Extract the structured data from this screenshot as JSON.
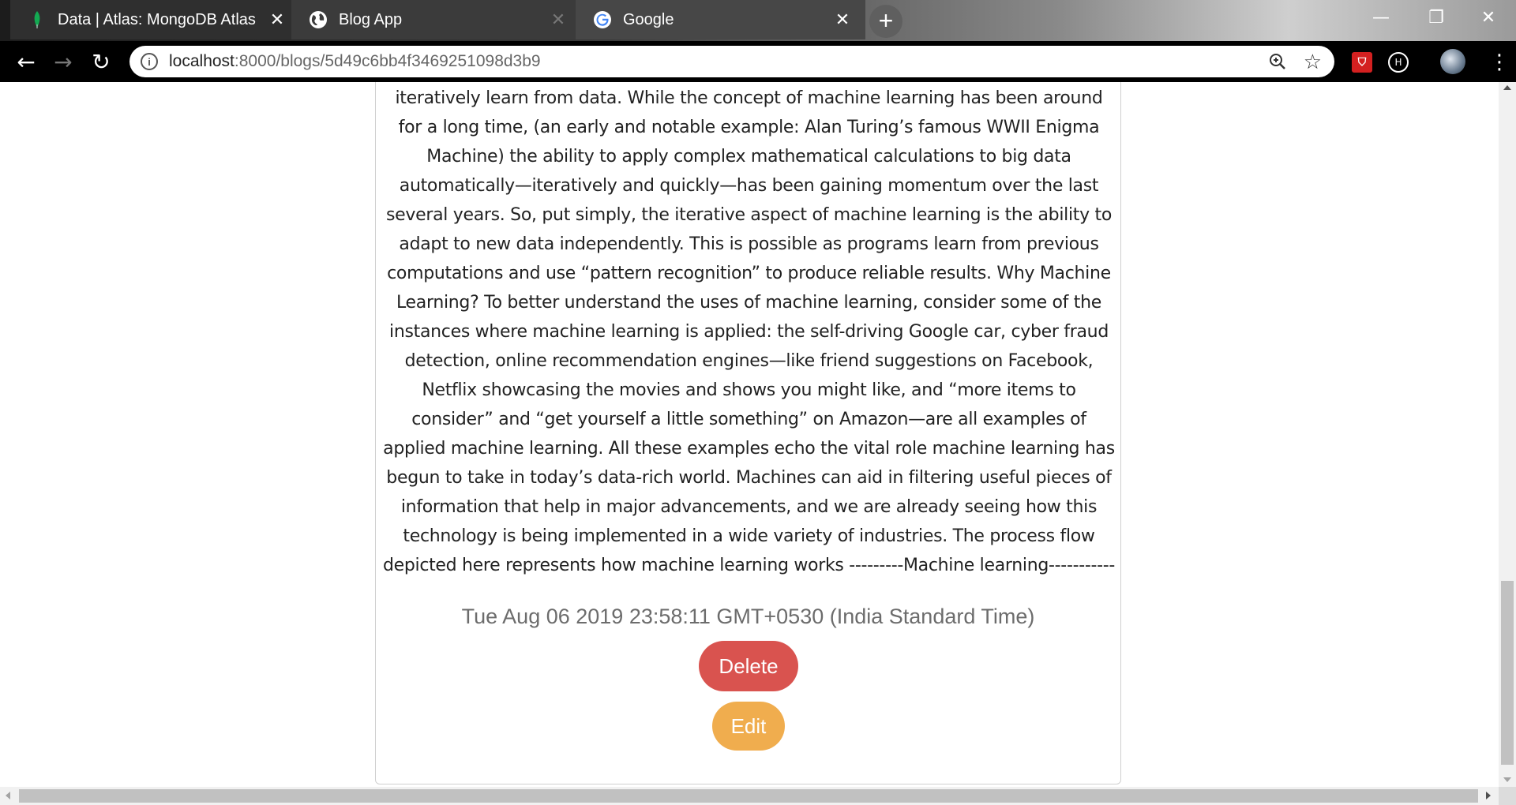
{
  "browser": {
    "tabs": [
      {
        "title": "Data | Atlas: MongoDB Atlas",
        "favicon": "mongodb-leaf-icon"
      },
      {
        "title": "Blog App",
        "favicon": "globe-icon"
      },
      {
        "title": "Google",
        "favicon": "google-g-icon"
      }
    ],
    "new_tab_label": "+",
    "window_controls": {
      "minimize": "—",
      "maximize": "❐",
      "close": "✕"
    },
    "nav": {
      "back": "←",
      "forward": "→",
      "reload": "↻"
    },
    "address": {
      "host": "localhost",
      "path": ":8000/blogs/5d49c6bb4f3469251098d3b9"
    },
    "icons": {
      "zoom": "zoom-icon",
      "star": "☆",
      "ext1": "pocket-icon",
      "ext2": "extension-icon",
      "menu": "⋮"
    }
  },
  "blog": {
    "body": "a particular piece of information; instead, it does this by using algorithms that iteratively learn from data. While the concept of machine learning has been around for a long time, (an early and notable example: Alan Turing’s famous WWII Enigma Machine) the ability to apply complex mathematical calculations to big data automatically—iteratively and quickly—has been gaining momentum over the last several years. So, put simply, the iterative aspect of machine learning is the ability to adapt to new data independently. This is possible as programs learn from previous computations and use “pattern recognition” to produce reliable results. Why Machine Learning? To better understand the uses of machine learning, consider some of the instances where machine learning is applied: the self-driving Google car, cyber fraud detection, online recommendation engines—like friend suggestions on Facebook, Netflix showcasing the movies and shows you might like, and “more items to consider” and “get yourself a little something” on Amazon—are all examples of applied machine learning. All these examples echo the vital role machine learning has begun to take in today’s data-rich world. Machines can aid in filtering useful pieces of information that help in major advancements, and we are already seeing how this technology is being implemented in a wide variety of industries. The process flow depicted here represents how machine learning works ---------Machine learning------------------------------------------------------",
    "created": "Tue Aug 06 2019 23:58:11 GMT+0530 (India Standard Time)",
    "delete_label": "Delete",
    "edit_label": "Edit"
  },
  "colors": {
    "delete": "#d9534f",
    "edit": "#f0ad4e",
    "timestamp": "#6c6c6c"
  }
}
